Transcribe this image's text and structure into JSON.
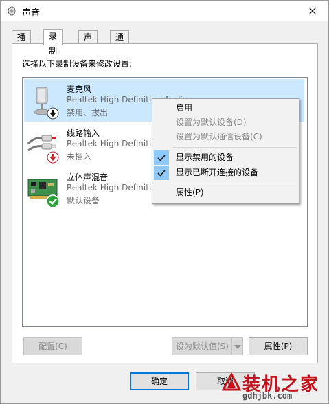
{
  "window": {
    "title": "声音"
  },
  "tabs": [
    {
      "label": "播放"
    },
    {
      "label": "录制"
    },
    {
      "label": "声音"
    },
    {
      "label": "通信"
    }
  ],
  "instruction": "选择以下录制设备来修改设置:",
  "devices": [
    {
      "name": "麦克风",
      "driver": "Realtek High Definition Audio",
      "status": "禁用、拔出",
      "icon": "microphone-icon",
      "badge": "disabled-arrow-badge",
      "selected": true
    },
    {
      "name": "线路输入",
      "driver": "Realtek High Definition Audio",
      "status": "未插入",
      "icon": "line-in-cable-icon",
      "badge": "unplugged-red-arrow-badge",
      "selected": false
    },
    {
      "name": "立体声混音",
      "driver": "Realtek High Definition Audio",
      "status": "默认设备",
      "icon": "sound-card-icon",
      "badge": "default-checkmark-badge",
      "selected": false
    }
  ],
  "context_menu": {
    "items": [
      {
        "label": "启用",
        "enabled": true,
        "checked": false
      },
      {
        "label": "设置为默认设备(D)",
        "enabled": false,
        "checked": false
      },
      {
        "label": "设置为默认通信设备(C)",
        "enabled": false,
        "checked": false
      },
      {
        "label": "显示禁用的设备",
        "enabled": true,
        "checked": true
      },
      {
        "label": "显示已断开连接的设备",
        "enabled": true,
        "checked": true
      },
      {
        "label": "属性(P)",
        "enabled": true,
        "checked": false
      }
    ]
  },
  "buttons": {
    "configure": "配置(C)",
    "set_default": "设为默认值(S)",
    "properties": "属性(P)",
    "ok": "确定",
    "cancel": "取消"
  },
  "watermark": {
    "title": "装机之家",
    "url": "gdhjbk.com"
  },
  "colors": {
    "selection": "#cce8ff",
    "check_bg": "#90c8f6",
    "accent": "#0078d7",
    "watermark_red": "#c4141b"
  }
}
